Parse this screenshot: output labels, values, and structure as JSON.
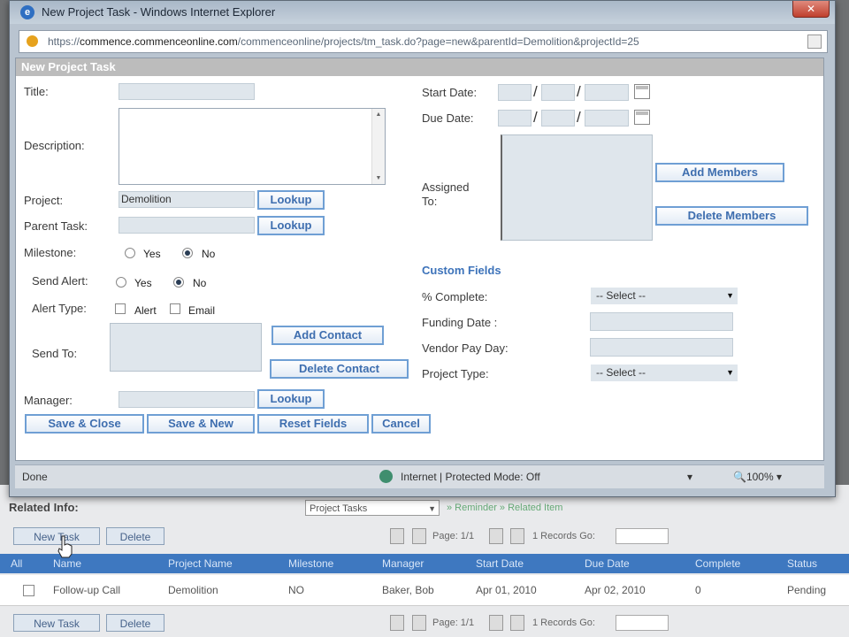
{
  "window": {
    "title": "New Project Task - Windows Internet Explorer",
    "url_prefix": "https://",
    "url_domain": "commence.commenceonline.com",
    "url_suffix": "/commenceonline/projects/tm_task.do?page=new&parentId=Demolition&projectId=25",
    "close_label": "✕",
    "ie_icon": "e"
  },
  "dialog": {
    "header": "New Project Task",
    "labels": {
      "title": "Title:",
      "description": "Description:",
      "project": "Project:",
      "parent_task": "Parent Task:",
      "milestone": "Milestone:",
      "send_alert": "Send Alert:",
      "alert_type": "Alert Type:",
      "send_to": "Send To:",
      "manager": "Manager:",
      "start_date": "Start Date:",
      "due_date": "Due Date:",
      "assigned_to_1": "Assigned",
      "assigned_to_2": "To:"
    },
    "fields": {
      "title": "",
      "project": "Demolition",
      "parent_task": "",
      "manager": ""
    },
    "milestone": {
      "yes": "Yes",
      "no": "No",
      "selected": "no"
    },
    "send_alert": {
      "yes": "Yes",
      "no": "No",
      "selected": "no"
    },
    "alert_type": {
      "alert": "Alert",
      "email": "Email"
    },
    "buttons": {
      "lookup": "Lookup",
      "add_contact": "Add Contact",
      "delete_contact": "Delete Contact",
      "add_members": "Add Members",
      "delete_members": "Delete Members",
      "save_close": "Save & Close",
      "save_new": "Save & New",
      "reset_fields": "Reset Fields",
      "cancel": "Cancel"
    },
    "custom_fields": {
      "title": "Custom Fields",
      "percent_complete_label": "% Complete:",
      "percent_complete_value": "-- Select --",
      "funding_date_label": "Funding Date :",
      "vendor_pay_day_label": "Vendor Pay Day:",
      "project_type_label": "Project Type:",
      "project_type_value": "-- Select --"
    }
  },
  "statusbar": {
    "done": "Done",
    "zone": "Internet | Protected Mode: Off",
    "misc": "▾",
    "zoom": "🔍100%  ▾"
  },
  "background": {
    "related_info": "Related Info:",
    "related_select": "Project Tasks",
    "links": "» Reminder » Related Item",
    "new_task": "New Task",
    "delete": "Delete",
    "pager": "Page: 1/1",
    "records": "1 Records  Go:",
    "table_headers": [
      "All",
      "Name",
      "Project Name",
      "Milestone",
      "Manager",
      "Start Date",
      "Due Date",
      "Complete",
      "Status"
    ],
    "row": [
      "Follow-up Call",
      "Demolition",
      "NO",
      "Baker, Bob",
      "Apr 01, 2010",
      "Apr 02, 2010",
      "0",
      "Pending"
    ]
  }
}
